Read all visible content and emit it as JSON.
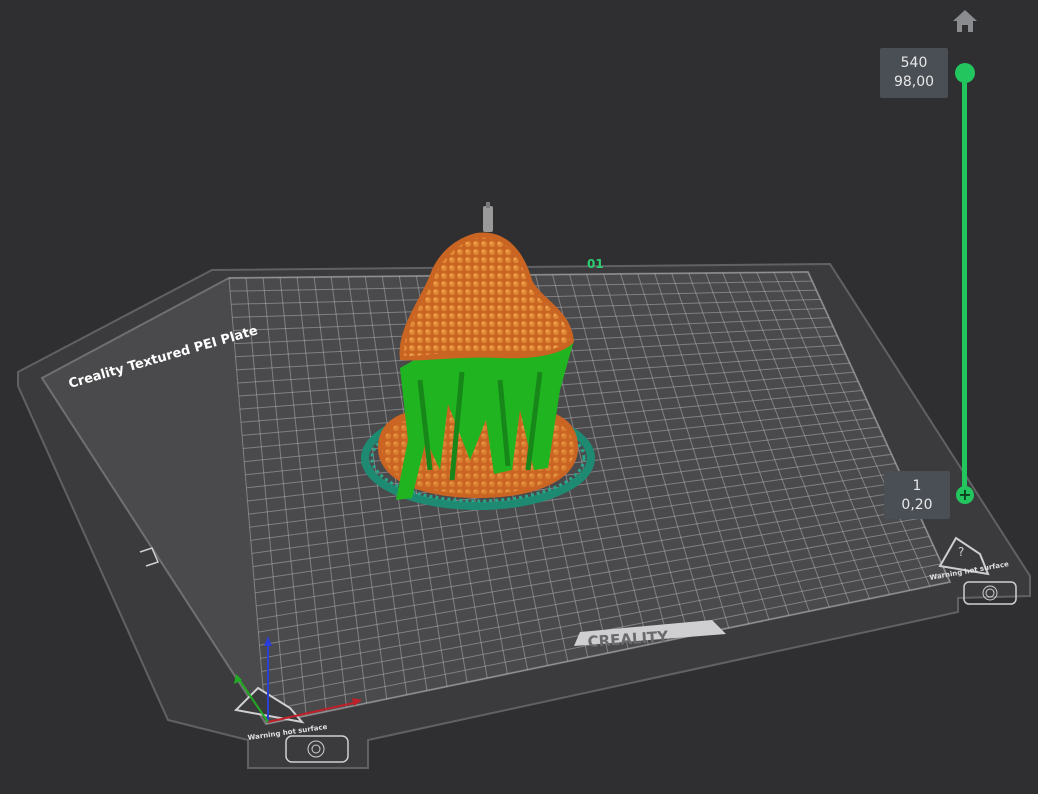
{
  "viewport": {
    "plate_name": "Creality Textured PEI Plate",
    "plate_number": "01",
    "brand_logo": "CREALITY",
    "warning_text_left": "Warning hot surface",
    "warning_text_right": "Warning hot surface",
    "warning_symbol": "?"
  },
  "layer_slider": {
    "top_layer": "540",
    "top_height": "98,00",
    "bottom_layer": "1",
    "bottom_height": "0,20",
    "color": "#22c55e"
  },
  "toolbar": {
    "home_icon": "home-icon"
  },
  "colors": {
    "background": "#2f2f31",
    "plate": "#3b3b3d",
    "model": "#d2772b",
    "support": "#21b421",
    "brim": "#1e8a72",
    "axis_x": "#c0202a",
    "axis_y": "#22aa22",
    "axis_z": "#2a3ed8"
  }
}
